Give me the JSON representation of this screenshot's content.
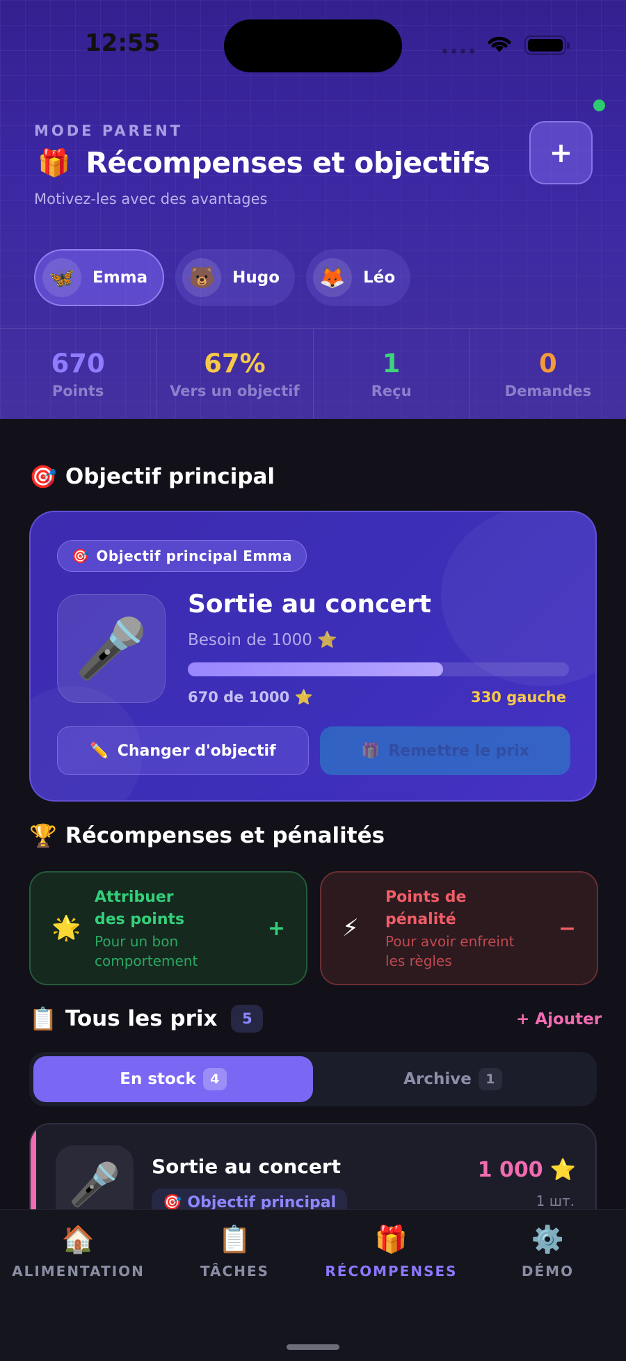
{
  "status_bar": {
    "time": "12:55"
  },
  "header": {
    "mode": "MODE PARENT",
    "title_icon": "🎁",
    "title": "Récompenses et objectifs",
    "subtitle": "Motivez-les avec des avantages",
    "add_label": "+"
  },
  "kids": [
    {
      "emoji": "🦋",
      "name": "Emma",
      "active": true
    },
    {
      "emoji": "🐻",
      "name": "Hugo",
      "active": false
    },
    {
      "emoji": "🦊",
      "name": "Léo",
      "active": false
    }
  ],
  "stats": [
    {
      "value": "670",
      "label": "Points",
      "color": "#8f7dff"
    },
    {
      "value": "67%",
      "label": "Vers un objectif",
      "color": "#f7c948"
    },
    {
      "value": "1",
      "label": "Reçu",
      "color": "#3ed27d"
    },
    {
      "value": "0",
      "label": "Demandes",
      "color": "#f39a3b"
    }
  ],
  "main_goal": {
    "section_icon": "🎯",
    "section_title": "Objectif principal",
    "badge_icon": "🎯",
    "badge": "Objectif principal Emma",
    "image": "🎤",
    "name": "Sortie au concert",
    "need": "Besoin de 1000 ⭐",
    "progress": 0.67,
    "progress_text": "670 de 1000 ⭐",
    "left_text": "330 gauche",
    "change_icon": "✏️",
    "change_label": "Changer d'objectif",
    "award_icon": "🎁",
    "award_label": "Remettre le prix"
  },
  "rewards_section": {
    "icon": "🏆",
    "title": "Récompenses et pénalités",
    "award": {
      "icon": "🌟",
      "title_l1": "Attribuer",
      "title_l2": "des points",
      "sub_l1": "Pour un bon",
      "sub_l2": "comportement",
      "symbol": "+"
    },
    "penalty": {
      "icon": "⚡",
      "title_l1": "Points de",
      "title_l2": "pénalité",
      "sub_l1": "Pour avoir enfreint",
      "sub_l2": "les règles",
      "symbol": "−"
    }
  },
  "prizes": {
    "icon": "📋",
    "title": "Tous les prix",
    "count": "5",
    "add_link": "+ Ajouter",
    "tabs": [
      {
        "label": "En stock",
        "count": "4",
        "active": true
      },
      {
        "label": "Archive",
        "count": "1",
        "active": false
      }
    ],
    "items": [
      {
        "image": "🎤",
        "name": "Sortie au concert",
        "tag_icon": "🎯",
        "tag": "Objectif principal",
        "price": "1 000",
        "price_icon": "⭐",
        "qty": "1 шт."
      }
    ]
  },
  "nav": [
    {
      "icon": "🏠",
      "label": "ALIMENTATION",
      "active": false
    },
    {
      "icon": "📋",
      "label": "TÂCHES",
      "active": false
    },
    {
      "icon": "🎁",
      "label": "RÉCOMPENSES",
      "active": true
    },
    {
      "icon": "⚙️",
      "label": "DÉMO",
      "active": false
    }
  ]
}
